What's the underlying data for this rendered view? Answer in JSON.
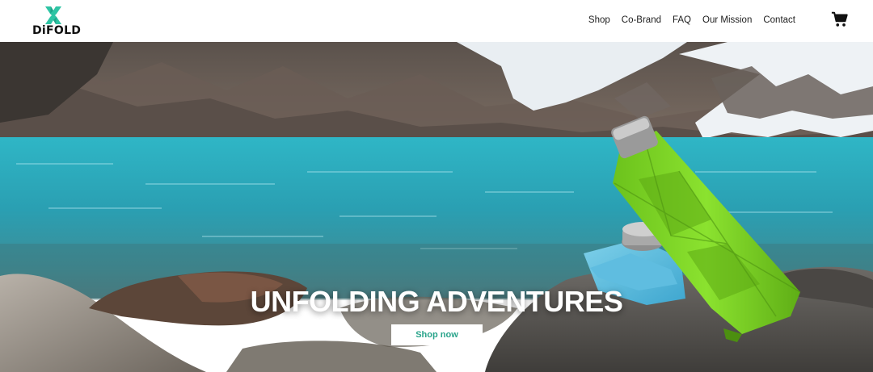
{
  "brand": {
    "name": "DiFOLD",
    "logo_icon": "difold-x-icon",
    "accent_color": "#2ec4a4"
  },
  "nav": {
    "items": [
      {
        "label": "Shop"
      },
      {
        "label": "Co-Brand"
      },
      {
        "label": "FAQ"
      },
      {
        "label": "Our Mission"
      },
      {
        "label": "Contact"
      }
    ],
    "cart_icon": "shopping-cart-icon"
  },
  "hero": {
    "title": "UNFOLDING ADVENTURES",
    "cta_label": "Shop now",
    "cta_text_color": "#2aa48b",
    "product_color": "#7ed321"
  }
}
